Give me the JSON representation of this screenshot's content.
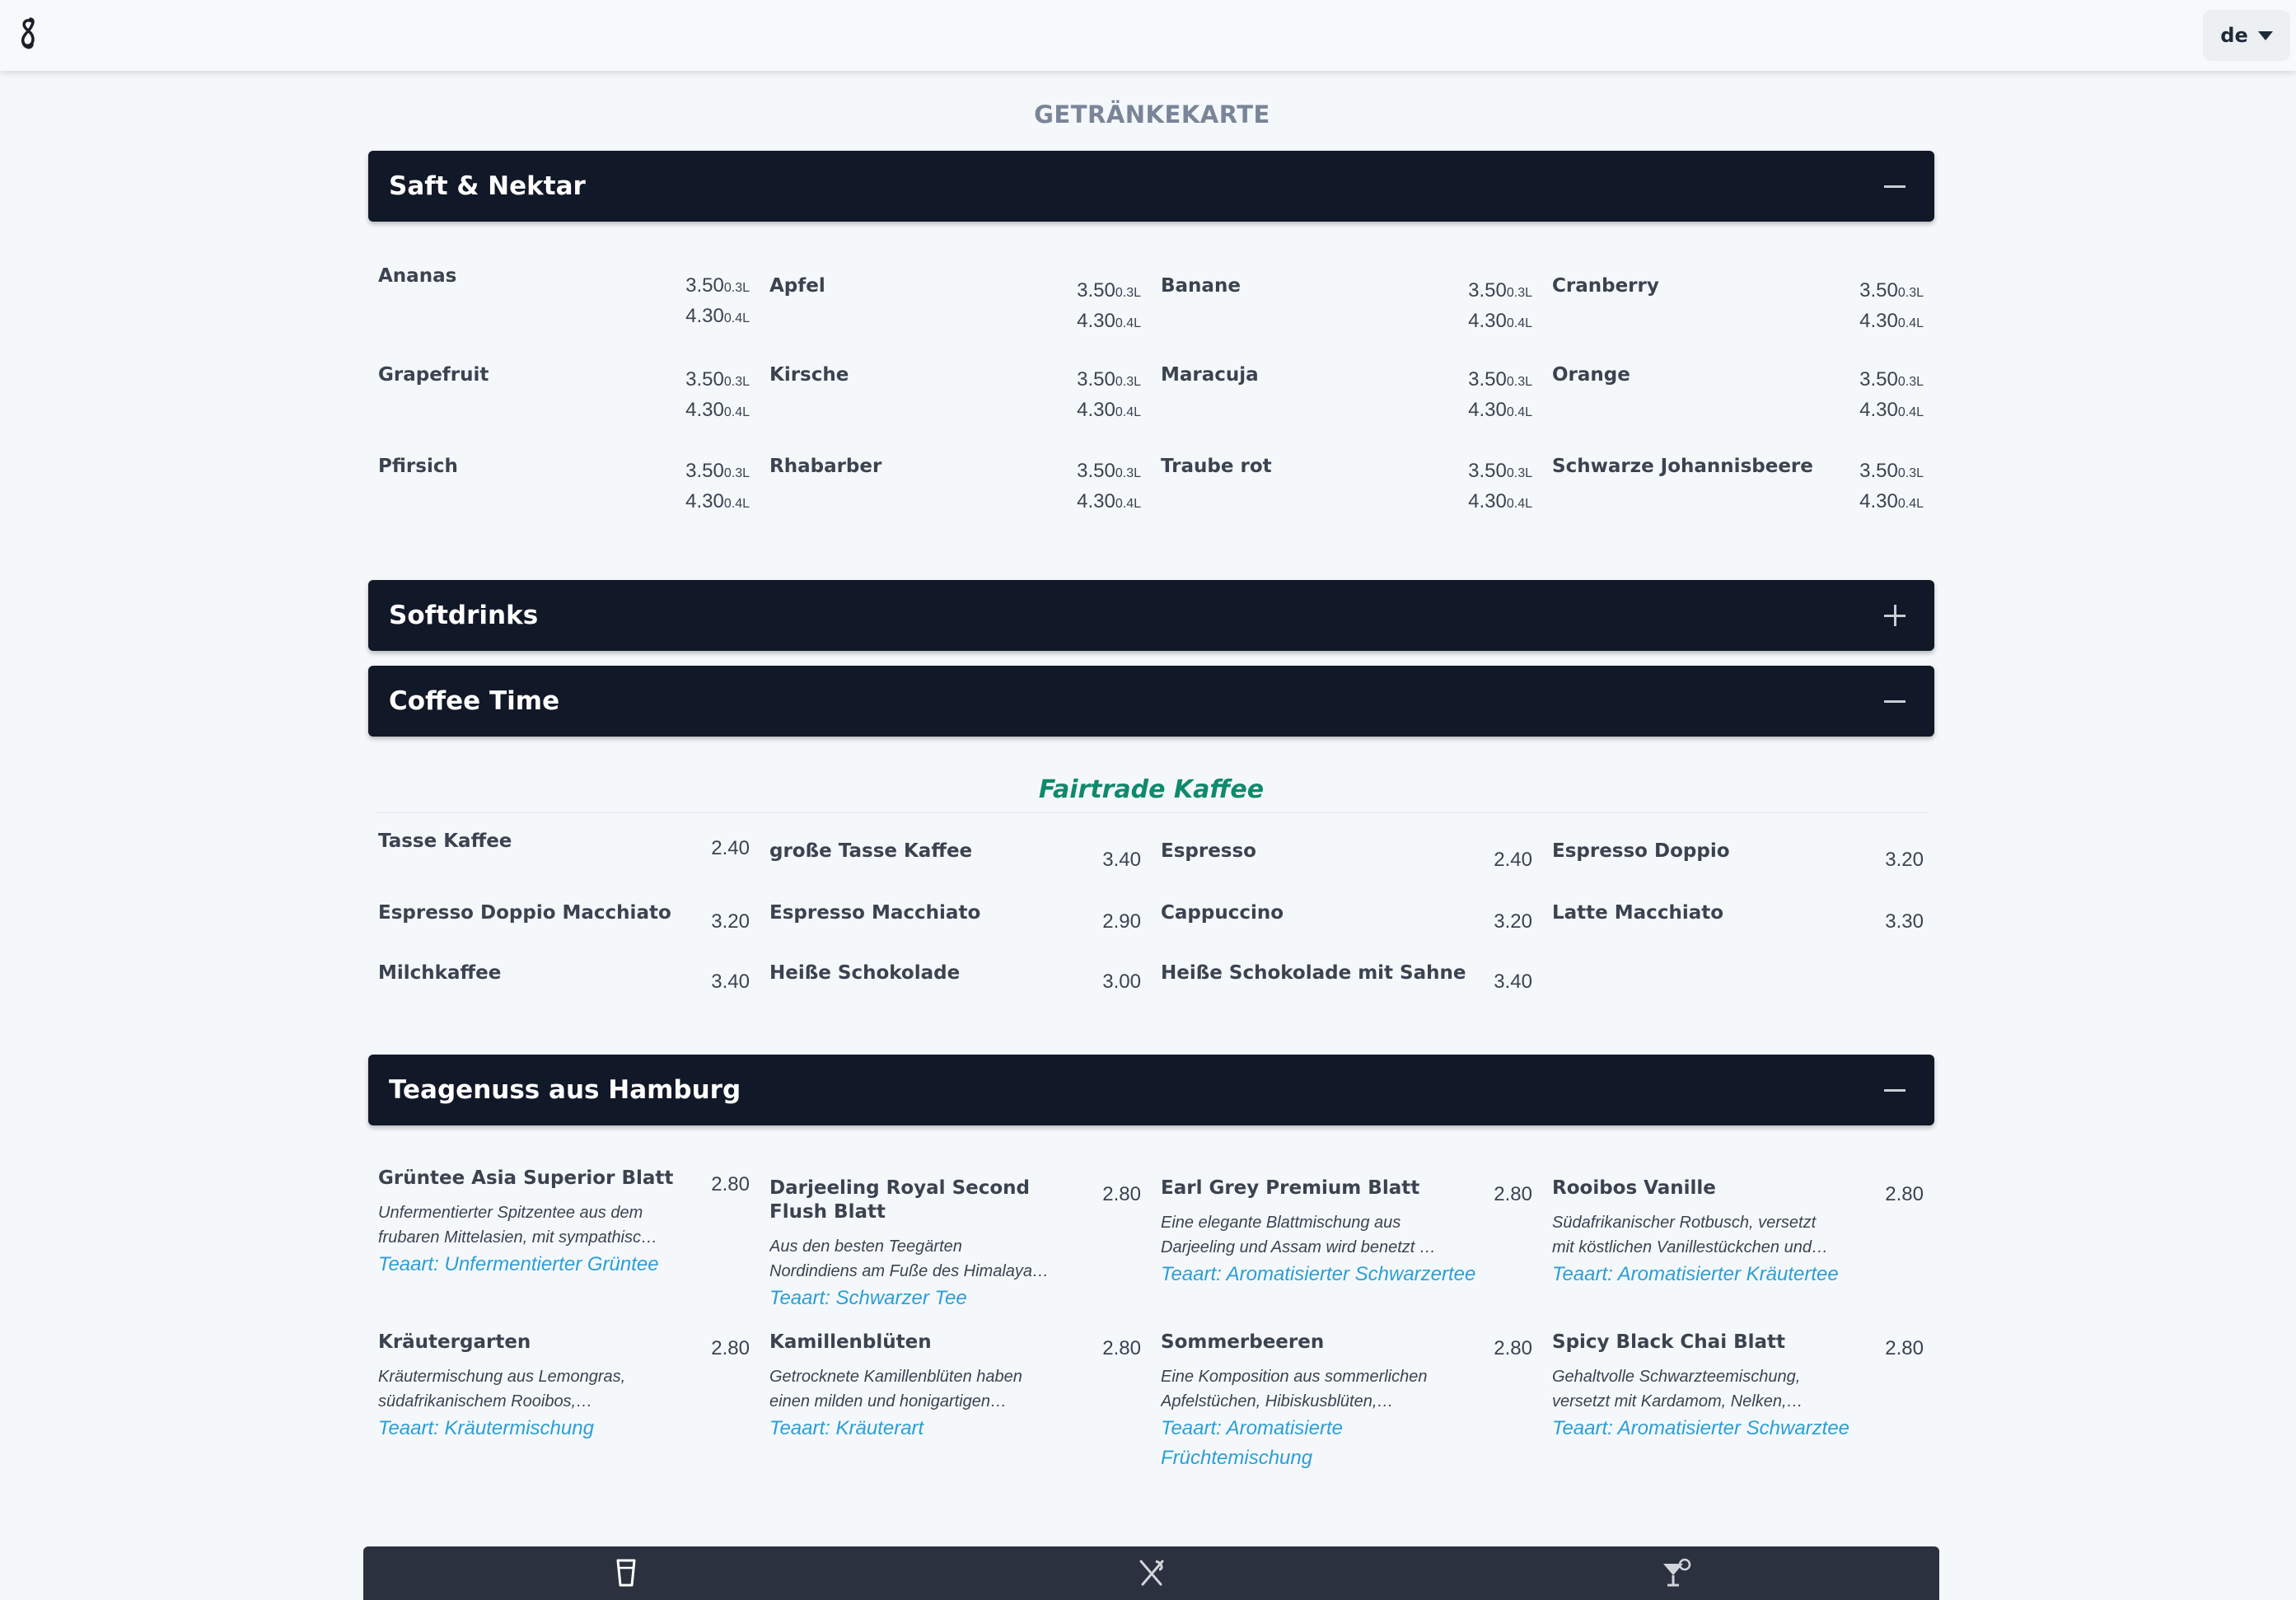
{
  "header": {
    "language": "de"
  },
  "page_title": "GETRÄNKEKARTE",
  "saft": {
    "title": "Saft & Nektar",
    "items": [
      {
        "name": "Ananas",
        "p1": "3.50",
        "u1": "0.3L",
        "p2": "4.30",
        "u2": "0.4L"
      },
      {
        "name": "Apfel",
        "p1": "3.50",
        "u1": "0.3L",
        "p2": "4.30",
        "u2": "0.4L"
      },
      {
        "name": "Banane",
        "p1": "3.50",
        "u1": "0.3L",
        "p2": "4.30",
        "u2": "0.4L"
      },
      {
        "name": "Cranberry",
        "p1": "3.50",
        "u1": "0.3L",
        "p2": "4.30",
        "u2": "0.4L"
      },
      {
        "name": "Grapefruit",
        "p1": "3.50",
        "u1": "0.3L",
        "p2": "4.30",
        "u2": "0.4L"
      },
      {
        "name": "Kirsche",
        "p1": "3.50",
        "u1": "0.3L",
        "p2": "4.30",
        "u2": "0.4L"
      },
      {
        "name": "Maracuja",
        "p1": "3.50",
        "u1": "0.3L",
        "p2": "4.30",
        "u2": "0.4L"
      },
      {
        "name": "Orange",
        "p1": "3.50",
        "u1": "0.3L",
        "p2": "4.30",
        "u2": "0.4L"
      },
      {
        "name": "Pfirsich",
        "p1": "3.50",
        "u1": "0.3L",
        "p2": "4.30",
        "u2": "0.4L"
      },
      {
        "name": "Rhabarber",
        "p1": "3.50",
        "u1": "0.3L",
        "p2": "4.30",
        "u2": "0.4L"
      },
      {
        "name": "Traube rot",
        "p1": "3.50",
        "u1": "0.3L",
        "p2": "4.30",
        "u2": "0.4L"
      },
      {
        "name": "Schwarze Johannisbeere",
        "p1": "3.50",
        "u1": "0.3L",
        "p2": "4.30",
        "u2": "0.4L"
      }
    ]
  },
  "softdrinks": {
    "title": "Softdrinks"
  },
  "coffee": {
    "title": "Coffee Time",
    "subheading": "Fairtrade Kaffee",
    "items": [
      {
        "name": "Tasse Kaffee",
        "price": "2.40"
      },
      {
        "name": "große Tasse Kaffee",
        "price": "3.40"
      },
      {
        "name": "Espresso",
        "price": "2.40"
      },
      {
        "name": "Espresso Doppio",
        "price": "3.20"
      },
      {
        "name": "Espresso Doppio Macchiato",
        "price": "3.20"
      },
      {
        "name": "Espresso Macchiato",
        "price": "2.90"
      },
      {
        "name": "Cappuccino",
        "price": "3.20"
      },
      {
        "name": "Latte Macchiato",
        "price": "3.30"
      },
      {
        "name": "Milchkaffee",
        "price": "3.40"
      },
      {
        "name": "Heiße Schokolade",
        "price": "3.00"
      },
      {
        "name": "Heiße Schokolade mit Sahne",
        "price": "3.40"
      }
    ]
  },
  "tea": {
    "title": "Teagenuss aus Hamburg",
    "items": [
      {
        "name": "Grüntee Asia Superior Blatt",
        "price": "2.80",
        "desc1": "Unfermentierter Spitzentee aus dem",
        "desc2": "frubaren Mittelasien, mit sympathisc…",
        "type": "Teaart: Unfermentierter Grüntee"
      },
      {
        "name": "Darjeeling Royal Second Flush Blatt",
        "price": "2.80",
        "desc1": "Aus den besten Teegärten",
        "desc2": "Nordindiens am Fuße des Himalaya…",
        "type": "Teaart: Schwarzer Tee"
      },
      {
        "name": "Earl Grey Premium Blatt",
        "price": "2.80",
        "desc1": "Eine elegante Blattmischung aus",
        "desc2": "Darjeeling und Assam wird benetzt …",
        "type": "Teaart: Aromatisierter Schwarzertee"
      },
      {
        "name": "Rooibos Vanille",
        "price": "2.80",
        "desc1": "Südafrikanischer Rotbusch, versetzt",
        "desc2": "mit köstlichen Vanillestückchen und…",
        "type": "Teaart: Aromatisierter Kräutertee"
      },
      {
        "name": "Kräutergarten",
        "price": "2.80",
        "desc1": "Kräutermischung aus Lemongras,",
        "desc2": "südafrikanischem Rooibos,…",
        "type": "Teaart: Kräutermischung"
      },
      {
        "name": "Kamillenblüten",
        "price": "2.80",
        "desc1": "Getrocknete Kamillenblüten haben",
        "desc2": "einen milden und honigartigen…",
        "type": "Teaart: Kräuterart"
      },
      {
        "name": "Sommerbeeren",
        "price": "2.80",
        "desc1": "Eine Komposition aus sommerlichen",
        "desc2": "Apfelstüchen, Hibiskusblüten,…",
        "type": "Teaart: Aromatisierte Früchtemischung"
      },
      {
        "name": "Spicy Black Chai Blatt",
        "price": "2.80",
        "desc1": "Gehaltvolle Schwarzteemischung,",
        "desc2": "versetzt mit Kardamom, Nelken,…",
        "type": "Teaart: Aromatisierter Schwarztee"
      }
    ]
  },
  "bottom_nav": {
    "icons": [
      "drink-cup-icon",
      "cutlery-icon",
      "cocktail-icon"
    ]
  }
}
